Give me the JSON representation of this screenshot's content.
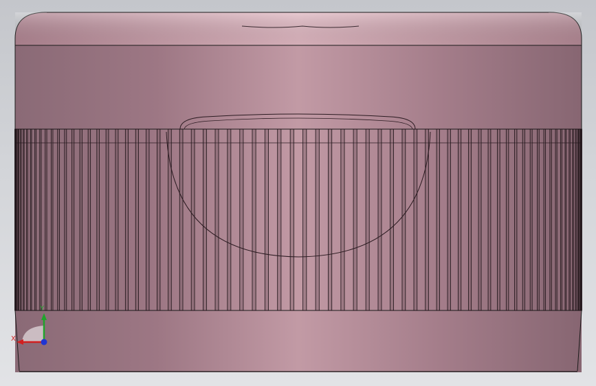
{
  "viewport": {
    "background_top": "#c4c6cb",
    "background_bottom": "#e2e3e6"
  },
  "model": {
    "part": "knurled-cap",
    "body_color_dark": "#8e6c78",
    "body_color_light": "#c59ba6",
    "edge_color": "#1a1a1a",
    "knurl_rib_count": 70
  },
  "triad": {
    "x_label": "X",
    "y_label": "Y",
    "x_color": "#d21f1f",
    "y_color": "#1fa52b",
    "z_color": "#1f35d2"
  }
}
